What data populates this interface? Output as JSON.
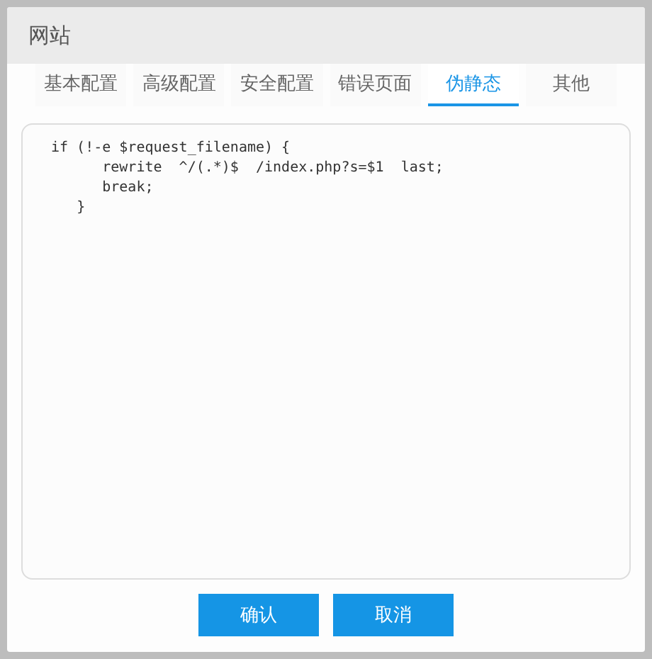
{
  "window": {
    "title": "网站"
  },
  "tabs": [
    {
      "label": "基本配置",
      "selected": false
    },
    {
      "label": "高级配置",
      "selected": false
    },
    {
      "label": "安全配置",
      "selected": false
    },
    {
      "label": "错误页面",
      "selected": false
    },
    {
      "label": "伪静态",
      "selected": true
    },
    {
      "label": "其他",
      "selected": false
    }
  ],
  "editor": {
    "value": "if (!-e $request_filename) {\n      rewrite  ^/(.*)$  /index.php?s=$1  last;\n      break;\n   }"
  },
  "buttons": [
    {
      "label": "确认"
    },
    {
      "label": "取消"
    }
  ]
}
